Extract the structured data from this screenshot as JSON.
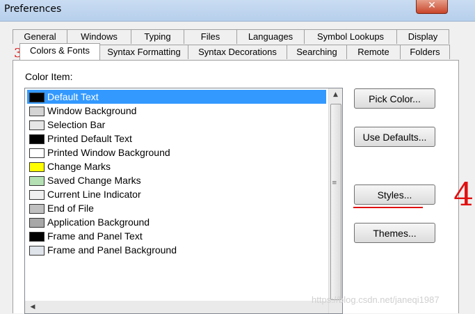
{
  "window": {
    "title": "Preferences",
    "close_label": "✕"
  },
  "tabs_row1": [
    "General",
    "Windows",
    "Typing",
    "Files",
    "Languages",
    "Symbol Lookups",
    "Display"
  ],
  "tabs_row2": [
    "Colors & Fonts",
    "Syntax Formatting",
    "Syntax Decorations",
    "Searching",
    "Remote",
    "Folders"
  ],
  "active_tab": "Colors & Fonts",
  "color_item_label": "Color Item:",
  "color_items": [
    {
      "label": "Default Text",
      "color": "#000000",
      "selected": true
    },
    {
      "label": "Window Background",
      "color": "#d4d4d4"
    },
    {
      "label": "Selection Bar",
      "color": "#e6e6e6"
    },
    {
      "label": "Printed Default Text",
      "color": "#000000"
    },
    {
      "label": "Printed Window Background",
      "color": "#ffffff"
    },
    {
      "label": "Change Marks",
      "color": "#ffff00"
    },
    {
      "label": "Saved Change Marks",
      "color": "#b4e0b4"
    },
    {
      "label": "Current Line Indicator",
      "color": "#f0f0f0"
    },
    {
      "label": "End of File",
      "color": "#c0c0c0"
    },
    {
      "label": "Application Background",
      "color": "#a8a8a8"
    },
    {
      "label": "Frame and Panel Text",
      "color": "#000000"
    },
    {
      "label": "Frame and Panel Background",
      "color": "#dfe3ea"
    }
  ],
  "buttons": {
    "pick_color": "Pick Color...",
    "use_defaults": "Use Defaults...",
    "styles": "Styles...",
    "themes": "Themes..."
  },
  "annotations": {
    "left_number": "3",
    "right_number": "4",
    "color": "#e01010"
  },
  "watermark": "https://blog.csdn.net/janeqi1987"
}
